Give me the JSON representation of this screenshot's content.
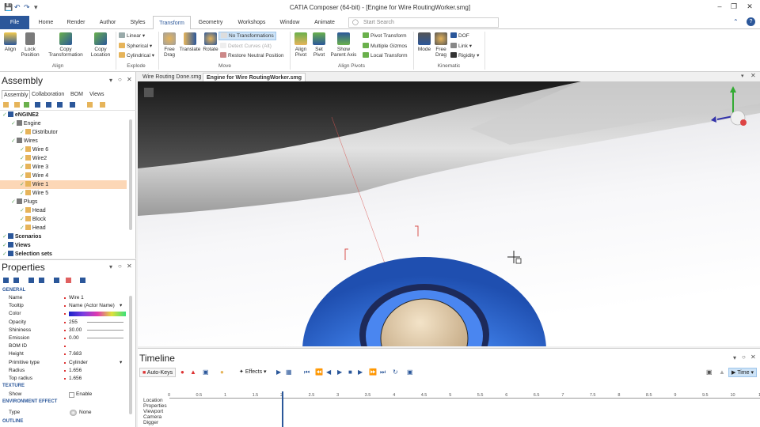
{
  "window": {
    "title": "CATIA Composer (64-bit) - [Engine for Wire RoutingWorker.smg]"
  },
  "ribbon_tabs": [
    {
      "label": "File"
    },
    {
      "label": "Home"
    },
    {
      "label": "Render"
    },
    {
      "label": "Author"
    },
    {
      "label": "Styles"
    },
    {
      "label": "Transform"
    },
    {
      "label": "Geometry"
    },
    {
      "label": "Workshops"
    },
    {
      "label": "Window"
    },
    {
      "label": "Animate"
    }
  ],
  "search": {
    "placeholder": "Start Search"
  },
  "ribbon": {
    "align_group": {
      "label": "Align",
      "align": "Align",
      "lock_position": "Lock Position",
      "copy_transformation": "Copy Transformation",
      "copy_location": "Copy Location"
    },
    "explode_group": {
      "label": "Explode",
      "linear": "Linear",
      "spherical": "Spherical",
      "cylindrical": "Cylindrical"
    },
    "move_group": {
      "label": "Move",
      "free_drag": "Free Drag",
      "translate": "Translate",
      "rotate": "Rotate",
      "no_transformations": "No Transformations",
      "detect_curves": "Detect Curves (Alt)",
      "restore_neutral": "Restore Neutral Position"
    },
    "align_pivots_group": {
      "label": "Align Pivots",
      "align_pivot": "Align Pivot",
      "set_pivot": "Set Pivot",
      "show_parent_axis": "Show Parent Axis",
      "pivot_transform": "Pivot Transform",
      "multiple_gizmos": "Multiple Gizmos",
      "local_transform": "Local Transform"
    },
    "kinematic_group": {
      "label": "Kinematic",
      "mode": "Mode",
      "free_drag": "Free Drag",
      "dof": "DOF",
      "link": "Link",
      "rigidity": "Rigidity"
    }
  },
  "assembly": {
    "title": "Assembly",
    "tabs": [
      "Assembly",
      "Collaboration",
      "BOM",
      "Views"
    ],
    "tree": [
      {
        "label": "eNGINE2",
        "bold": true,
        "indent": 0
      },
      {
        "label": "Engine",
        "indent": 1
      },
      {
        "label": "Distributor",
        "indent": 2
      },
      {
        "label": "Wires",
        "indent": 1
      },
      {
        "label": "Wire 6",
        "indent": 2
      },
      {
        "label": "Wire2",
        "indent": 2
      },
      {
        "label": "Wire 3",
        "indent": 2
      },
      {
        "label": "Wire 4",
        "indent": 2
      },
      {
        "label": "Wire 1",
        "indent": 2,
        "selected": true
      },
      {
        "label": "Wire 5",
        "indent": 2
      },
      {
        "label": "Plugs",
        "indent": 1
      },
      {
        "label": "Head",
        "indent": 2
      },
      {
        "label": "Block",
        "indent": 2
      },
      {
        "label": "Head",
        "indent": 2
      },
      {
        "label": "Scenarios",
        "bold": true,
        "indent": 0
      },
      {
        "label": "Views",
        "bold": true,
        "indent": 0
      },
      {
        "label": "Selection sets",
        "bold": true,
        "indent": 0
      }
    ]
  },
  "properties": {
    "title": "Properties",
    "categories": {
      "general": "GENERAL",
      "texture": "TEXTURE",
      "environment": "ENVIRONMENT EFFECT",
      "outline": "OUTLINE"
    },
    "rows": [
      {
        "key": "Name",
        "value": "Wire 1"
      },
      {
        "key": "Tooltip",
        "value": "Name (Actor Name)"
      },
      {
        "key": "Color",
        "value": ""
      },
      {
        "key": "Opacity",
        "value": "255"
      },
      {
        "key": "Shininess",
        "value": "30.00"
      },
      {
        "key": "Emission",
        "value": "0.00"
      },
      {
        "key": "BOM ID",
        "value": ""
      },
      {
        "key": "Height",
        "value": "7.683"
      },
      {
        "key": "Primitive type",
        "value": "Cylinder"
      },
      {
        "key": "Radius",
        "value": "1.656"
      },
      {
        "key": "Top radius",
        "value": "1.656"
      }
    ],
    "texture_rows": [
      {
        "key": "Show",
        "value": "Enable"
      }
    ],
    "env_rows": [
      {
        "key": "Type",
        "value": "None"
      }
    ]
  },
  "documents": {
    "tabs": [
      "Wire Routing Done.smg",
      "Engine for Wire RoutingWorker.smg"
    ]
  },
  "timeline": {
    "title": "Timeline",
    "auto_keys": "Auto-Keys",
    "effects": "Effects",
    "time": "Time",
    "ticks": [
      "0",
      "0.5",
      "1",
      "1.5",
      "2",
      "2.5",
      "3",
      "3.5",
      "4",
      "4.5",
      "5",
      "5.5",
      "6",
      "6.5",
      "7",
      "7.5",
      "8",
      "8.5",
      "9",
      "9.5",
      "10",
      "10.5"
    ],
    "cursor_time": 2,
    "tracks": [
      "Location",
      "Properties",
      "Viewport",
      "Camera",
      "Digger"
    ]
  },
  "colors": {
    "accent": "#2b579a",
    "selection": "#fcd7b6",
    "viewport_part": "#3a78e0"
  }
}
